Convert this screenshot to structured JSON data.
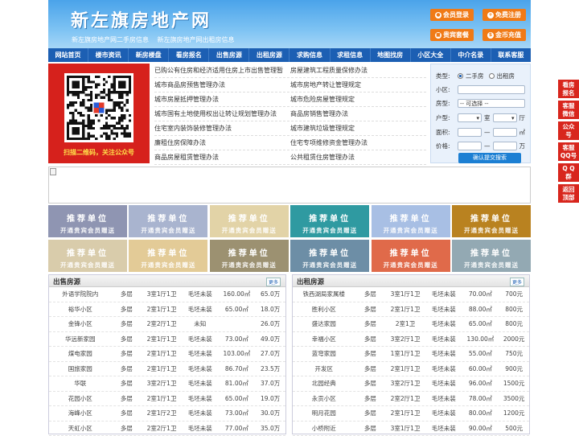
{
  "header": {
    "logo": "新左旗房地产网",
    "subtitles": [
      "新左旗房地产网二手房信息",
      "新左旗房地产网出租房信息"
    ],
    "buttons": [
      {
        "label": "会员登录",
        "icon": "user-icon"
      },
      {
        "label": "免费注册",
        "icon": "user-add-icon"
      },
      {
        "label": "贵宾套餐",
        "icon": "gift-icon"
      },
      {
        "label": "金币充值",
        "icon": "coin-icon"
      }
    ]
  },
  "nav": [
    "网站首页",
    "楼市资讯",
    "新房楼盘",
    "看房报名",
    "出售房源",
    "出租房源",
    "求购信息",
    "求租信息",
    "地图找房",
    "小区大全",
    "中介名录",
    "联系客服"
  ],
  "qr_caption": "扫描二维码，关注公众号",
  "news": [
    [
      "已购公有住房和经济适用住房上市出售管理暂",
      "房屋建筑工程质量保修办法"
    ],
    [
      "城市商品房预售管理办法",
      "城市房地产转让管理规定"
    ],
    [
      "城市房屋抵押管理办法",
      "城市危险房屋管理规定"
    ],
    [
      "城市国有土地使用权出让转让规划管理办法",
      "商品房销售管理办法"
    ],
    [
      "住宅室内装饰装修管理办法",
      "城市建筑垃圾管理规定"
    ],
    [
      "廉租住房保障办法",
      "住宅专项维修资金管理办法"
    ],
    [
      "商品房屋租赁管理办法",
      "公共租赁住房管理办法"
    ]
  ],
  "search": {
    "type_label": "类型:",
    "type_options": [
      "二手房",
      "出租房"
    ],
    "type_selected": "二手房",
    "community_label": "小区:",
    "housetype_label": "房型:",
    "housetype_value": "-- 可选择 --",
    "layout_label": "户型:",
    "layout_units": [
      "室",
      "厅"
    ],
    "area_label": "面积:",
    "area_unit": "㎡",
    "price_label": "价格:",
    "price_unit": "万",
    "range_sep": "—",
    "submit": "确认提交搜索"
  },
  "tiles": {
    "title": "推荐单位",
    "subtitle": "开通贵宾会员赠送",
    "colors": [
      "#8f95b2",
      "#a9b4cf",
      "#e2d3a7",
      "#2f9aa1",
      "#a8bfe4",
      "#b98220",
      "#d9ccab",
      "#e3cb97",
      "#9c9171",
      "#6d8ea6",
      "#e06a4a",
      "#93a9b3"
    ]
  },
  "sale": {
    "title": "出售房源",
    "more": "更多",
    "rows": [
      [
        "外语学院院内",
        "多层",
        "3室1厅1卫",
        "毛坯未装",
        "160.00㎡",
        "65.0万"
      ],
      [
        "裕华小区",
        "多层",
        "2室1厅1卫",
        "毛坯未装",
        "65.00㎡",
        "18.0万"
      ],
      [
        "金锋小区",
        "多层",
        "2室2厅1卫",
        "未知",
        "",
        "26.0万"
      ],
      [
        "华远新家园",
        "多层",
        "2室1厅1卫",
        "毛坯未装",
        "73.00㎡",
        "49.0万"
      ],
      [
        "煤电家园",
        "多层",
        "2室1厅1卫",
        "毛坯未装",
        "103.00㎡",
        "27.0万"
      ],
      [
        "国旅家园",
        "多层",
        "2室1厅1卫",
        "毛坯未装",
        "86.70㎡",
        "23.5万"
      ],
      [
        "华联",
        "多层",
        "3室2厅1卫",
        "毛坯未装",
        "81.00㎡",
        "37.0万"
      ],
      [
        "花园小区",
        "多层",
        "2室1厅1卫",
        "毛坯未装",
        "65.00㎡",
        "19.0万"
      ],
      [
        "海峰小区",
        "多层",
        "2室1厅2卫",
        "毛坯未装",
        "73.00㎡",
        "30.0万"
      ],
      [
        "天虹小区",
        "多层",
        "2室2厅1卫",
        "毛坯未装",
        "77.00㎡",
        "35.0万"
      ]
    ]
  },
  "rent": {
    "title": "出租房源",
    "more": "更多",
    "rows": [
      [
        "铁西湖局家属楼",
        "多层",
        "3室1厅1卫",
        "毛坯未装",
        "70.00㎡",
        "700元"
      ],
      [
        "胜利小区",
        "多层",
        "2室1厅1卫",
        "毛坯未装",
        "88.00㎡",
        "800元"
      ],
      [
        "盛达家园",
        "多层",
        "2室1卫",
        "毛坯未装",
        "65.00㎡",
        "800元"
      ],
      [
        "幸福小区",
        "多层",
        "3室2厅1卫",
        "毛坯未装",
        "130.00㎡",
        "2000元"
      ],
      [
        "蓝穹家园",
        "多层",
        "1室1厅1卫",
        "毛坯未装",
        "55.00㎡",
        "750元"
      ],
      [
        "开发区",
        "多层",
        "2室1厅1卫",
        "毛坯未装",
        "60.00㎡",
        "900元"
      ],
      [
        "北园经典",
        "多层",
        "3室2厅1卫",
        "毛坯未装",
        "96.00㎡",
        "1500元"
      ],
      [
        "永贡小区",
        "多层",
        "2室2厅1卫",
        "毛坯未装",
        "78.00㎡",
        "3500元"
      ],
      [
        "明月花园",
        "多层",
        "2室1厅1卫",
        "毛坯未装",
        "80.00㎡",
        "1200元"
      ],
      [
        "小桥附近",
        "多层",
        "3室1厅1卫",
        "毛坯未装",
        "90.00㎡",
        "500元"
      ]
    ]
  },
  "side": [
    {
      "label": "看房报名",
      "lines": [
        "看房",
        "报名"
      ]
    },
    {
      "label": "客服微信",
      "lines": [
        "客服",
        "微信"
      ]
    },
    {
      "label": "公众号",
      "lines": [
        "公众",
        "号"
      ]
    },
    {
      "label": "客服QQ号",
      "lines": [
        "客服",
        "QQ号"
      ]
    },
    {
      "label": "QQ群",
      "lines": [
        "Q Q",
        "群"
      ]
    },
    {
      "label": "返回顶部",
      "lines": [
        "返回",
        "顶部"
      ]
    }
  ]
}
